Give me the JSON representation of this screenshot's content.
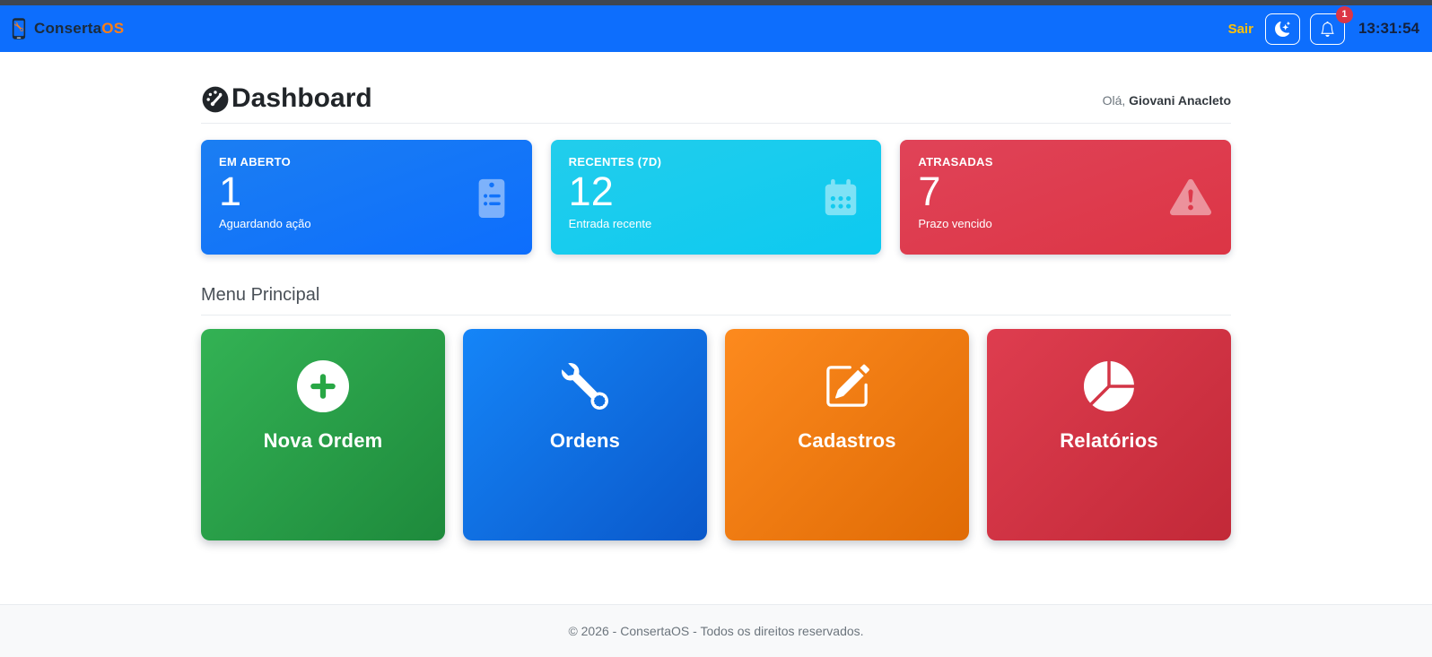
{
  "navbar": {
    "brand_primary": "Conserta",
    "brand_accent": "OS",
    "logout_label": "Sair",
    "notification_count": "1",
    "clock": "13:31:54"
  },
  "header": {
    "title": "Dashboard",
    "greeting_prefix": "Olá,",
    "user_name": "Giovani Anacleto"
  },
  "stats": [
    {
      "label": "EM ABERTO",
      "value": "1",
      "caption": "Aguardando ação",
      "icon": "clipboard-list-icon",
      "bg_style": "background:linear-gradient(160deg,#1b7ef2,#0d6efd)"
    },
    {
      "label": "RECENTES (7D)",
      "value": "12",
      "caption": "Entrada recente",
      "icon": "calendar-icon",
      "bg_style": "background:linear-gradient(160deg,#22cdec,#0dcaf0)"
    },
    {
      "label": "ATRASADAS",
      "value": "7",
      "caption": "Prazo vencido",
      "icon": "warning-triangle-icon",
      "bg_style": "background:linear-gradient(160deg,#e04358,#dc3545)"
    }
  ],
  "menu": {
    "section_title": "Menu Principal",
    "items": [
      {
        "label": "Nova Ordem",
        "icon": "plus-circle-icon",
        "bg_style": "background:linear-gradient(135deg,#33b254,#1e8a3c)"
      },
      {
        "label": "Ordens",
        "icon": "wrench-icon",
        "bg_style": "background:linear-gradient(135deg,#1585f8,#0a58ca)"
      },
      {
        "label": "Cadastros",
        "icon": "pencil-square-icon",
        "bg_style": "background:linear-gradient(135deg,#fd8a1e,#e06b05)"
      },
      {
        "label": "Relatórios",
        "icon": "pie-chart-icon",
        "bg_style": "background:linear-gradient(135deg,#de3d4f,#c22938)"
      }
    ]
  },
  "footer": {
    "text": "© 2026 - ConsertaOS - Todos os direitos reservados."
  },
  "theme": {
    "navbar_blue": "#0d6efd",
    "logout_yellow": "#ffc107",
    "badge_red": "#dc3545",
    "clock_navy": "#14213d",
    "brand_orange": "#fd7e14",
    "stat_blue": "#0d6efd",
    "stat_cyan": "#0dcaf0",
    "stat_red": "#dc3545",
    "footer_bg": "#f8f9fa"
  }
}
